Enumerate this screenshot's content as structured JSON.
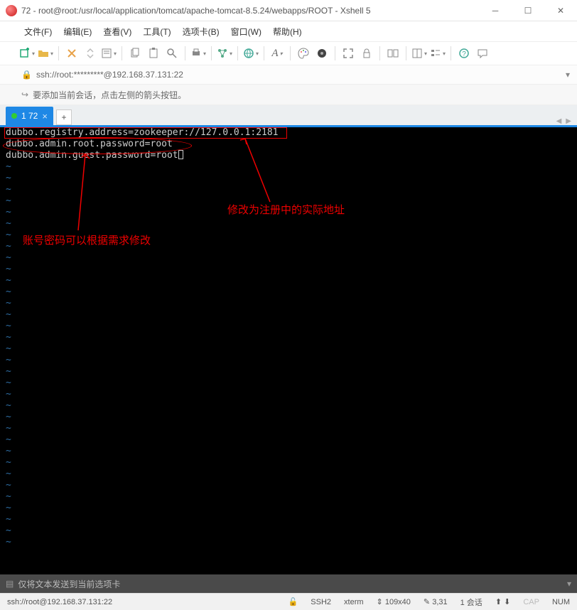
{
  "window": {
    "title": "72 - root@root:/usr/local/application/tomcat/apache-tomcat-8.5.24/webapps/ROOT - Xshell 5"
  },
  "menubar": {
    "items": [
      "文件(F)",
      "编辑(E)",
      "查看(V)",
      "工具(T)",
      "选项卡(B)",
      "窗口(W)",
      "帮助(H)"
    ]
  },
  "address": {
    "url": "ssh://root:*********@192.168.37.131:22"
  },
  "hint": {
    "text": "要添加当前会话，点击左侧的箭头按钮。"
  },
  "tab": {
    "label": "1 72",
    "add": "+"
  },
  "terminal": {
    "lines": [
      "dubbo.registry.address=zookeeper://127.0.0.1:2181",
      "dubbo.admin.root.password=root",
      "dubbo.admin.guest.password=root"
    ]
  },
  "annotations": {
    "note1": "修改为注册中的实际地址",
    "note2": "账号密码可以根据需求修改"
  },
  "sendbar": {
    "placeholder": "仅将文本发送到当前选项卡"
  },
  "status": {
    "conn": "ssh://root@192.168.37.131:22",
    "proto": "SSH2",
    "term": "xterm",
    "size": "109x40",
    "pos": "3,31",
    "sessions": "1 会话",
    "caps": "CAP",
    "num": "NUM"
  }
}
